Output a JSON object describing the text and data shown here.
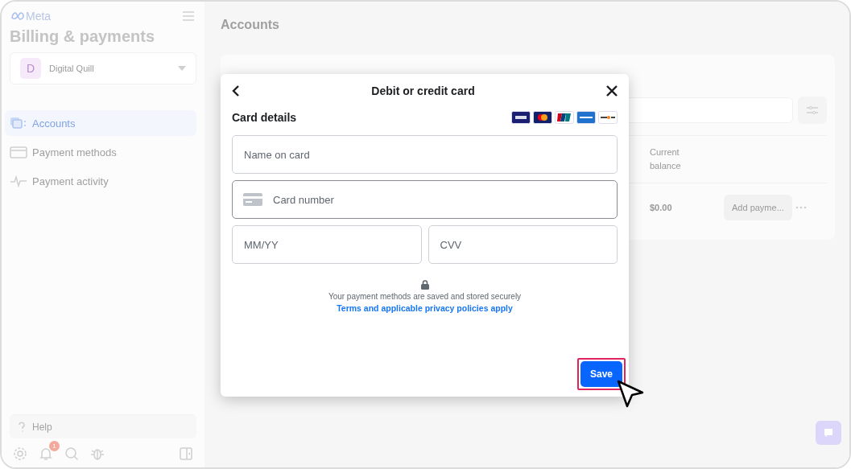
{
  "sidebar": {
    "logo": "Meta",
    "title": "Billing & payments",
    "account": {
      "initial": "D",
      "name": "Digital Quill"
    },
    "nav": [
      {
        "label": "Accounts",
        "selected": true
      },
      {
        "label": "Payment methods",
        "selected": false
      },
      {
        "label": "Payment activity",
        "selected": false
      }
    ],
    "help": "Help",
    "notification_count": "1"
  },
  "main": {
    "title": "Accounts",
    "table": {
      "columns": [
        "Current balance"
      ],
      "rows": [
        {
          "balance": "$0.00",
          "action": "Add payme..."
        }
      ]
    }
  },
  "dialog": {
    "title": "Debit or credit card",
    "section": "Card details",
    "field_rows": [
      {
        "fields": [
          {
            "kind": "text",
            "placeholder": "Name on card",
            "focused": false
          }
        ]
      },
      {
        "fields": [
          {
            "kind": "card_number",
            "placeholder": "Card number",
            "focused": true
          }
        ]
      },
      {
        "fields": [
          {
            "kind": "text",
            "placeholder": "MM/YY",
            "focused": false
          },
          {
            "kind": "text",
            "placeholder": "CVV",
            "focused": false
          }
        ]
      }
    ],
    "security_note": "Your payment methods are saved and stored securely",
    "link": "Terms and applicable privacy policies apply",
    "save": "Save",
    "save_highlighted": true
  }
}
